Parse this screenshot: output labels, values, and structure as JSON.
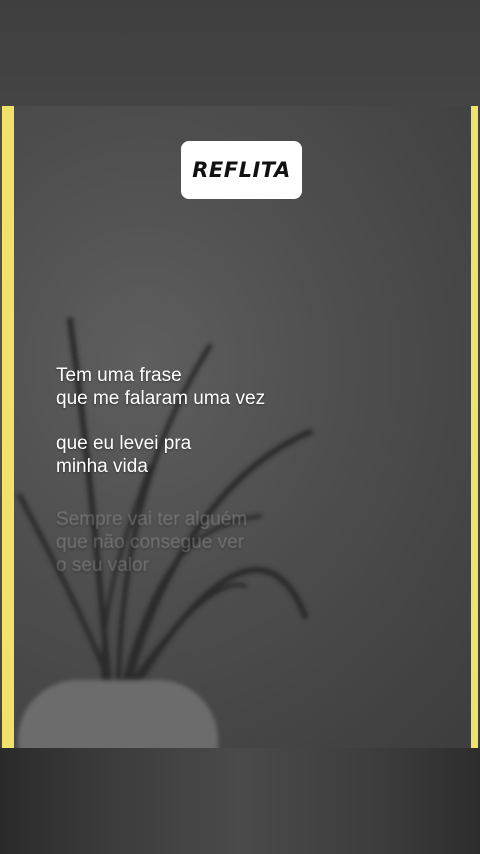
{
  "header": {
    "title": "REFLITA"
  },
  "captions": {
    "line1": "Tem uma frase",
    "line2": "que me falaram uma vez",
    "line3": "que eu levei pra",
    "line4": "minha vida",
    "line5": "Sempre vai ter alguém",
    "line6": "que não consegue ver",
    "line7": "o seu valor"
  },
  "colors": {
    "edge_bar": "#f1e36a",
    "title_card_bg": "#ffffff",
    "caption_text": "#ffffff"
  },
  "icons": {
    "background": "plant-silhouette"
  }
}
